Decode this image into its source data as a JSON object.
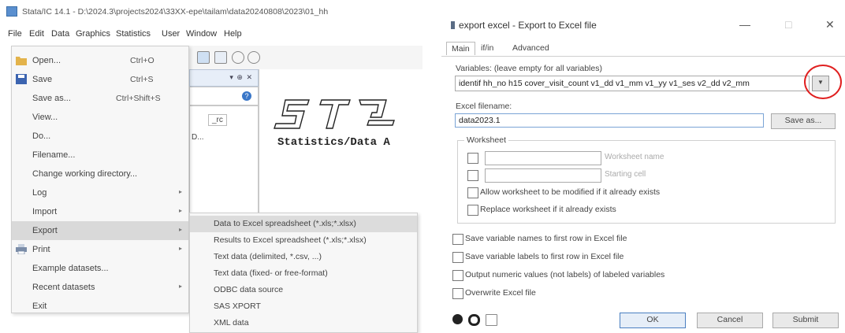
{
  "stata": {
    "title": "Stata/IC 14.1 - D:\\2024.3\\projects2024\\33XX-epe\\tailam\\data20240808\\2023\\01_hh",
    "menubar": [
      "File",
      "Edit",
      "Data",
      "Graphics",
      "Statistics",
      "User",
      "Window",
      "Help"
    ],
    "file_menu": [
      {
        "label": "Open...",
        "shortcut": "Ctrl+O",
        "icon": "open-folder-icon"
      },
      {
        "label": "Save",
        "shortcut": "Ctrl+S",
        "icon": "save-disk-icon"
      },
      {
        "label": "Save as...",
        "shortcut": "Ctrl+Shift+S"
      },
      {
        "label": "View..."
      },
      {
        "label": "Do..."
      },
      {
        "label": "Filename..."
      },
      {
        "label": "Change working directory..."
      },
      {
        "label": "Log",
        "submenu": true
      },
      {
        "label": "Import",
        "submenu": true
      },
      {
        "label": "Export",
        "submenu": true,
        "highlighted": true
      },
      {
        "label": "Print",
        "submenu": true,
        "icon": "printer-icon"
      },
      {
        "label": "Example datasets..."
      },
      {
        "label": "Recent datasets",
        "submenu": true
      },
      {
        "label": "Exit"
      }
    ],
    "export_submenu": [
      {
        "label": "Data to Excel spreadsheet (*.xls;*.xlsx)",
        "highlighted": true
      },
      {
        "label": "Results to Excel spreadsheet (*.xls;*.xlsx)"
      },
      {
        "label": "Text data (delimited, *.csv, ...)"
      },
      {
        "label": "Text data (fixed- or free-format)"
      },
      {
        "label": "ODBC data source"
      },
      {
        "label": "SAS XPORT"
      },
      {
        "label": "XML data"
      }
    ],
    "panel_item": "_rc",
    "panel_item2": "D...",
    "results_text": "Statistics/Data A",
    "help_badge": "?"
  },
  "dialog": {
    "title": "export excel - Export to Excel file",
    "controls": {
      "minimize": "—",
      "maximize": "□",
      "close": "✕"
    },
    "tabs": [
      "Main",
      "if/in",
      "Advanced"
    ],
    "variables_label": "Variables: (leave empty for all variables)",
    "variables_value": "identif hh_no h15 cover_visit_count v1_dd v1_mm v1_yy v1_ses v2_dd v2_mm",
    "excel_filename_label": "Excel filename:",
    "excel_filename_value": "data2023.1",
    "save_as_label": "Save as...",
    "worksheet_legend": "Worksheet",
    "worksheet_name_hint": "Worksheet name",
    "starting_cell_hint": "Starting cell",
    "allow_modify_label": "Allow worksheet to be modified if it already exists",
    "replace_worksheet_label": "Replace worksheet if it already exists",
    "options": [
      "Save variable names to first row in Excel file",
      "Save variable labels to first row in Excel file",
      "Output numeric values (not labels) of labeled variables",
      "Overwrite Excel file"
    ],
    "buttons": {
      "ok": "OK",
      "cancel": "Cancel",
      "submit": "Submit"
    }
  },
  "colors": {
    "highlight_circle": "#e02020",
    "menu_highlight": "#d9d9d9",
    "focus_border": "#7aa4d6"
  }
}
